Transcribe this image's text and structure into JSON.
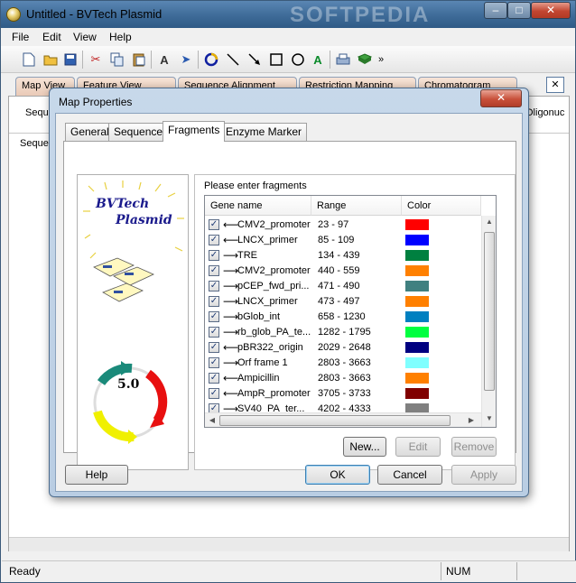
{
  "window": {
    "title": "Untitled - BVTech Plasmid",
    "watermark": "SOFTPEDIA",
    "min": "–",
    "max": "□",
    "close": "✕"
  },
  "menu": [
    "File",
    "Edit",
    "View",
    "Help"
  ],
  "toolbar_icons": [
    "new-file-icon",
    "open-folder-icon",
    "save-icon",
    "cut-icon",
    "copy-icon",
    "paste-icon",
    "find-icon",
    "select-arrow-icon",
    "circle-map-icon",
    "line-tool-icon",
    "arrow-tool-icon",
    "rectangle-tool-icon",
    "ellipse-tool-icon",
    "text-tool-icon",
    "print-icon",
    "book-icon",
    "more-icon"
  ],
  "main_tabs": [
    "Map View",
    "Feature View",
    "Sequence Alignment",
    "Restriction Mapping",
    "Chromatogram"
  ],
  "workarea": {
    "label1": "Seque",
    "label2": "Sequen",
    "label3": "Oligonuc"
  },
  "status": {
    "left": "Ready",
    "num": "NUM"
  },
  "dialog": {
    "title": "Map Properties",
    "close": "✕",
    "tabs": [
      "General",
      "Sequence",
      "Fragments",
      "Enzyme Marker"
    ],
    "active_tab": "Fragments",
    "logo_line1": "BVTech",
    "logo_line2": "Plasmid",
    "version": "5.0",
    "group_label": "Please enter fragments",
    "columns": [
      "Gene name",
      "Range",
      "Color"
    ],
    "fragments": [
      {
        "name": "CMV2_promoter",
        "range": "23 - 97",
        "dir": "left",
        "color": "#ff0000"
      },
      {
        "name": "LNCX_primer",
        "range": "85 - 109",
        "dir": "left",
        "color": "#0000ff"
      },
      {
        "name": "TRE",
        "range": "134 - 439",
        "dir": "right",
        "color": "#008040"
      },
      {
        "name": "CMV2_promoter",
        "range": "440 - 559",
        "dir": "right",
        "color": "#ff8000"
      },
      {
        "name": "pCEP_fwd_pri...",
        "range": "471 - 490",
        "dir": "right",
        "color": "#408080"
      },
      {
        "name": "LNCX_primer",
        "range": "473 - 497",
        "dir": "right",
        "color": "#ff8000"
      },
      {
        "name": "bGlob_int",
        "range": "658 - 1230",
        "dir": "right",
        "color": "#0080c0"
      },
      {
        "name": "rb_glob_PA_te...",
        "range": "1282 - 1795",
        "dir": "right",
        "color": "#00ff40"
      },
      {
        "name": "pBR322_origin",
        "range": "2029 - 2648",
        "dir": "left",
        "color": "#000080"
      },
      {
        "name": "Orf frame 1",
        "range": "2803 - 3663",
        "dir": "right",
        "color": "#80ffff"
      },
      {
        "name": "Ampicillin",
        "range": "2803 - 3663",
        "dir": "left",
        "color": "#ff8000"
      },
      {
        "name": "AmpR_promoter",
        "range": "3705 - 3733",
        "dir": "left",
        "color": "#800000"
      },
      {
        "name": "SV40_PA_ter...",
        "range": "4202 - 4333",
        "dir": "right",
        "color": "#808080"
      }
    ],
    "buttons": {
      "new": "New...",
      "edit": "Edit",
      "remove": "Remove",
      "help": "Help",
      "ok": "OK",
      "cancel": "Cancel",
      "apply": "Apply"
    }
  },
  "colors": {
    "plasmid_teal": "#1a8a7a",
    "plasmid_red": "#e81010",
    "plasmid_yellow": "#f0f000"
  }
}
